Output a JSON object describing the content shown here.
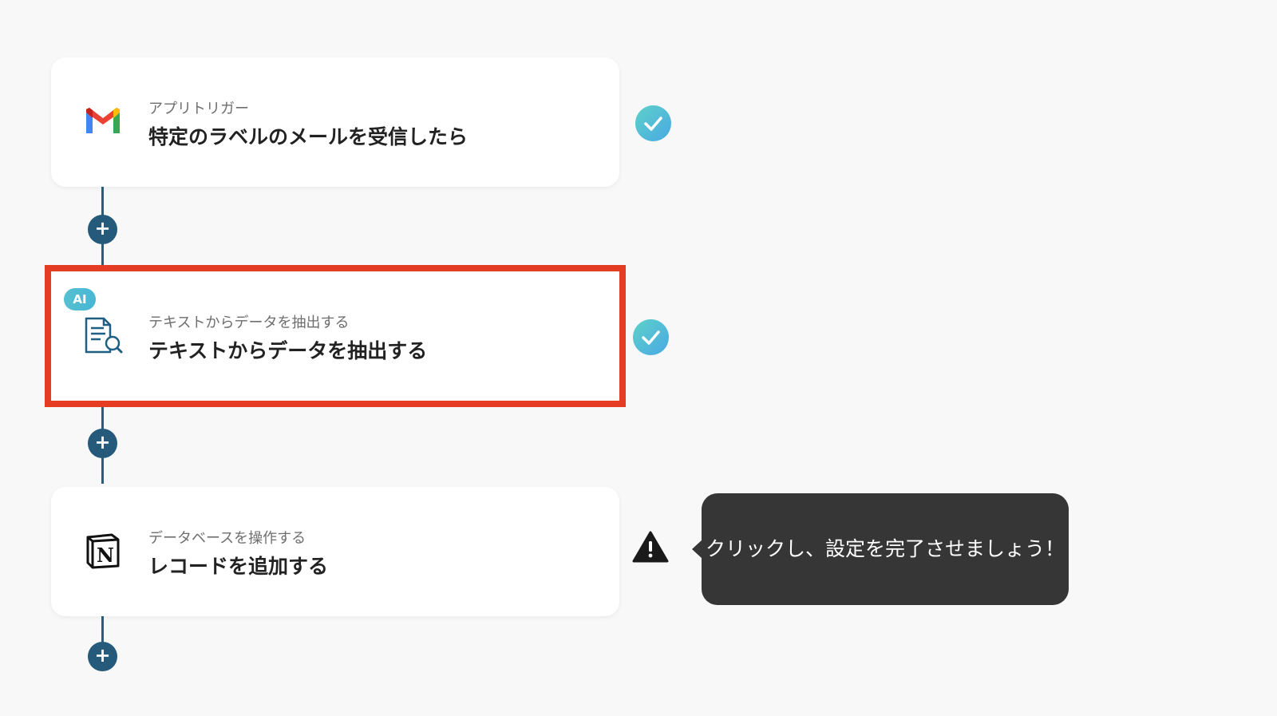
{
  "flow": {
    "steps": [
      {
        "subtitle": "アプリトリガー",
        "title": "特定のラベルのメールを受信したら",
        "icon": "gmail-icon",
        "status": "complete"
      },
      {
        "badge": "AI",
        "subtitle": "テキストからデータを抽出する",
        "title": "テキストからデータを抽出する",
        "icon": "document-search-icon",
        "status": "complete"
      },
      {
        "subtitle": "データベースを操作する",
        "title": "レコードを追加する",
        "icon": "notion-icon",
        "status": "warning"
      }
    ],
    "add_button_label": "+"
  },
  "tooltip": {
    "text": "クリックし、設定を完了させましょう！"
  },
  "colors": {
    "accent_connector": "#2a5d7c",
    "highlight": "#e43d23",
    "check": "#4fc3d6",
    "tooltip_bg": "#363636"
  }
}
